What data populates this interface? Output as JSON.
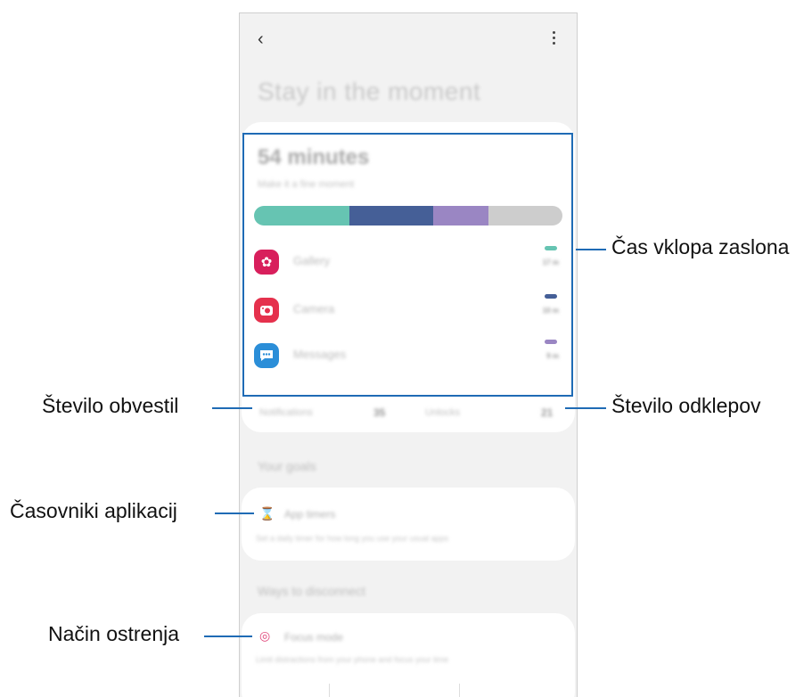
{
  "screen": {
    "title": "Stay in the moment",
    "usage": {
      "total_time": "54 minutes",
      "subtitle": "Make it a fine moment",
      "bar_segments": [
        {
          "app": "Gallery",
          "fraction": 0.31,
          "color": "#66c4b2"
        },
        {
          "app": "Camera",
          "fraction": 0.27,
          "color": "#455f97"
        },
        {
          "app": "Messages",
          "fraction": 0.18,
          "color": "#9a86c3"
        },
        {
          "app": "Other",
          "fraction": 0.24,
          "color": "#cdcdcd"
        }
      ],
      "apps": [
        {
          "name": "Gallery",
          "time": "17 m",
          "icon": "flower-icon",
          "color": "#d81f5c",
          "dash_color": "#66c4b2"
        },
        {
          "name": "Camera",
          "time": "10 m",
          "icon": "camera-icon",
          "color": "#e5314d",
          "dash_color": "#455f97"
        },
        {
          "name": "Messages",
          "time": "9 m",
          "icon": "chat-bubble-icon",
          "color": "#2b8ed8",
          "dash_color": "#9a86c3"
        }
      ]
    },
    "stats": {
      "notifications_label": "Notifications",
      "notifications_value": "35",
      "unlocks_label": "Unlocks",
      "unlocks_value": "21"
    },
    "goals": {
      "heading": "Your goals",
      "app_timers_title": "App timers",
      "app_timers_desc": "Set a daily timer for how long you use your usual apps",
      "app_timers_icon": "hourglass-icon"
    },
    "disconnect": {
      "heading": "Ways to disconnect",
      "focus_title": "Focus mode",
      "focus_desc": "Limit distractions from your phone and focus your time",
      "focus_icon": "target-icon"
    }
  },
  "annotations": {
    "screen_time": "Čas vklopa zaslona",
    "notifications": "Število obvestil",
    "unlocks": "Število odklepov",
    "app_timers": "Časovniki aplikacij",
    "focus_mode": "Način ostrenja"
  },
  "colors": {
    "accent_line": "#1f6bb5",
    "timer_icon": "#e08a55",
    "focus_icon": "#e0467a"
  }
}
